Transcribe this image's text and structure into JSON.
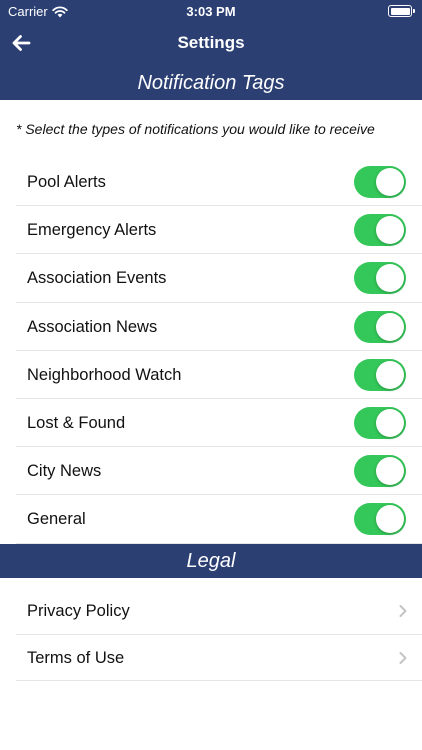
{
  "status": {
    "carrier": "Carrier",
    "time": "3:03 PM"
  },
  "nav": {
    "title": "Settings"
  },
  "notifications": {
    "section_title": "Notification Tags",
    "hint": "* Select the types of notifications you would like to receive",
    "items": [
      {
        "label": "Pool Alerts",
        "on": true
      },
      {
        "label": "Emergency Alerts",
        "on": true
      },
      {
        "label": "Association Events",
        "on": true
      },
      {
        "label": "Association News",
        "on": true
      },
      {
        "label": "Neighborhood Watch",
        "on": true
      },
      {
        "label": "Lost & Found",
        "on": true
      },
      {
        "label": "City News",
        "on": true
      },
      {
        "label": "General",
        "on": true
      }
    ]
  },
  "legal": {
    "section_title": "Legal",
    "items": [
      {
        "label": "Privacy Policy"
      },
      {
        "label": "Terms of Use"
      }
    ]
  },
  "colors": {
    "header": "#2b3f73",
    "toggle_on": "#34c759",
    "chevron": "#c4c4c6"
  }
}
